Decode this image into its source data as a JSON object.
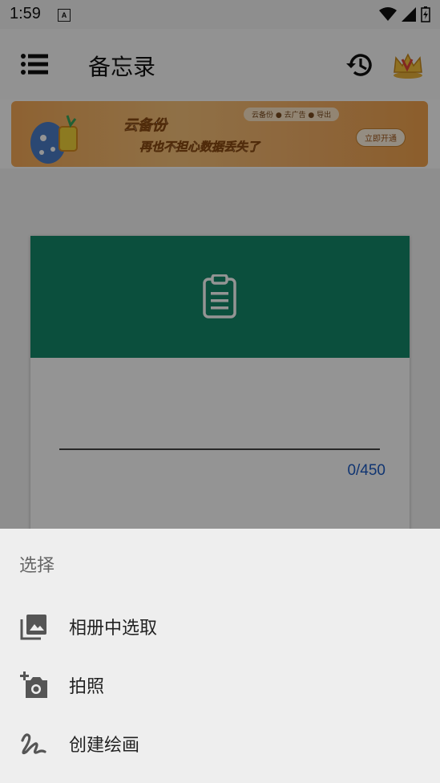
{
  "status_bar": {
    "time": "1:59",
    "notification_icon": "A"
  },
  "app_bar": {
    "title": "备忘录",
    "menu_icon": "list-icon",
    "history_icon": "history-icon",
    "vip_icon": "crown-icon"
  },
  "banner": {
    "headline": "云备份",
    "subline": "再也不担心数据丢失了",
    "tags": "云备份 ● 去广告 ● 导出",
    "cta": "立即开通"
  },
  "note_card": {
    "header_color": "#14896a",
    "icon": "clipboard-icon",
    "counter": "0/450"
  },
  "sheet": {
    "title": "选择",
    "options": [
      {
        "icon": "photo-library-icon",
        "label": "相册中选取"
      },
      {
        "icon": "add-camera-icon",
        "label": "拍照"
      },
      {
        "icon": "draw-icon",
        "label": "创建绘画"
      }
    ]
  }
}
